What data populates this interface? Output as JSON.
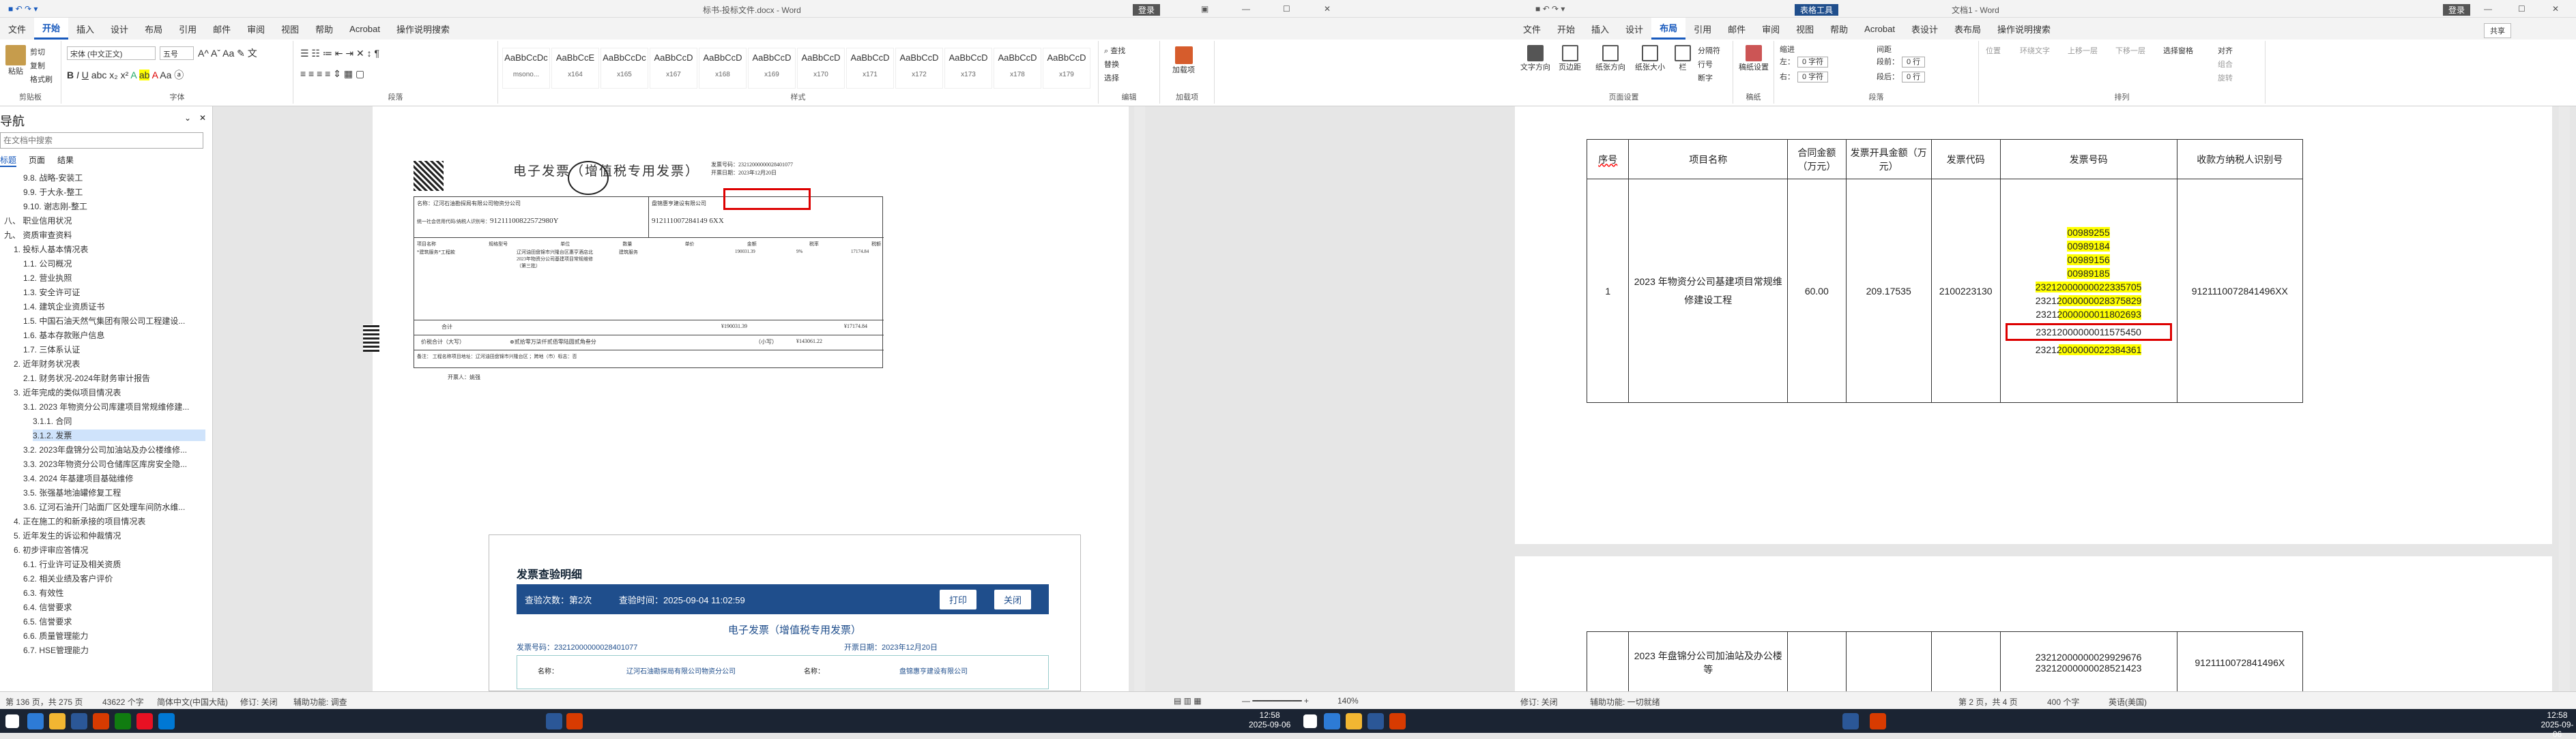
{
  "left_window": {
    "title": "标书-投标文件.docx - Word",
    "titlebar_user": "登录",
    "tabs": [
      "文件",
      "开始",
      "插入",
      "设计",
      "布局",
      "引用",
      "邮件",
      "审阅",
      "视图",
      "帮助",
      "Acrobat",
      "操作说明搜索"
    ],
    "active_tab": "开始",
    "ribbon": {
      "clipboard_label": "剪贴板",
      "paste": "粘贴",
      "cut": "剪切",
      "copy": "复制",
      "format_painter": "格式刷",
      "font_label": "字体",
      "font_name": "宋体 (中文正文)",
      "font_size": "五号",
      "paragraph_label": "段落",
      "styles_label": "样式",
      "styles": [
        {
          "p": "AaBbCcDc",
          "n": "msono..."
        },
        {
          "p": "AaBbCcE",
          "n": "x164"
        },
        {
          "p": "AaBbCcDc",
          "n": "x165"
        },
        {
          "p": "AaBbCcD",
          "n": "x167"
        },
        {
          "p": "AaBbCcD",
          "n": "x168"
        },
        {
          "p": "AaBbCcD",
          "n": "x169"
        },
        {
          "p": "AaBbCcD",
          "n": "x170"
        },
        {
          "p": "AaBbCcD",
          "n": "x171"
        },
        {
          "p": "AaBbCcD",
          "n": "x172"
        },
        {
          "p": "AaBbCcD",
          "n": "x173"
        },
        {
          "p": "AaBbCcD",
          "n": "x178"
        },
        {
          "p": "AaBbCcD",
          "n": "x179"
        }
      ],
      "editing_label": "编辑",
      "find": "查找",
      "replace": "替换",
      "select": "选择",
      "addin_label": "加载项",
      "addin": "加载项"
    },
    "nav": {
      "title": "导航",
      "search_placeholder": "在文档中搜索",
      "tabs": [
        "标题",
        "页面",
        "结果"
      ],
      "items": [
        {
          "t": "9.8. 战略-安装工",
          "i": 2
        },
        {
          "t": "9.9. 于大永-整工",
          "i": 2
        },
        {
          "t": "9.10. 谢志刚-整工",
          "i": 2
        },
        {
          "t": "八、 职业信用状况",
          "i": 0
        },
        {
          "t": "九、 资质审查资料",
          "i": 0
        },
        {
          "t": "1. 投标人基本情况表",
          "i": 1
        },
        {
          "t": "1.1. 公司概况",
          "i": 2
        },
        {
          "t": "1.2. 营业执照",
          "i": 2
        },
        {
          "t": "1.3. 安全许可证",
          "i": 2
        },
        {
          "t": "1.4. 建筑企业资质证书",
          "i": 2
        },
        {
          "t": "1.5. 中国石油天然气集团有限公司工程建设...",
          "i": 2
        },
        {
          "t": "1.6. 基本存款账户信息",
          "i": 2
        },
        {
          "t": "1.7. 三体系认证",
          "i": 2
        },
        {
          "t": "2. 近年财务状况表",
          "i": 1
        },
        {
          "t": "2.1. 财务状况-2024年财务审计报告",
          "i": 2
        },
        {
          "t": "3. 近年完成的类似项目情况表",
          "i": 1
        },
        {
          "t": "3.1. 2023 年物资分公司库建项目常规维修建...",
          "i": 2
        },
        {
          "t": "3.1.1. 合同",
          "i": 3
        },
        {
          "t": "3.1.2. 发票",
          "i": 3,
          "sel": true
        },
        {
          "t": "3.2. 2023年盘锦分公司加油站及办公楼维修...",
          "i": 2
        },
        {
          "t": "3.3. 2023年物资分公司仓储库区库房安全隐...",
          "i": 2
        },
        {
          "t": "3.4. 2024 年基建项目基础维修",
          "i": 2
        },
        {
          "t": "3.5. 张强基地油罐修复工程",
          "i": 2
        },
        {
          "t": "3.6. 辽河石油开门站面厂区处理车间防水维...",
          "i": 2
        },
        {
          "t": "4. 正在施工的和新承接的项目情况表",
          "i": 1
        },
        {
          "t": "5. 近年发生的诉讼和仲裁情况",
          "i": 1
        },
        {
          "t": "6. 初步评审应答情况",
          "i": 1
        },
        {
          "t": "6.1. 行业许可证及相关资质",
          "i": 2
        },
        {
          "t": "6.2. 相关业绩及客户评价",
          "i": 2
        },
        {
          "t": "6.3. 有效性",
          "i": 2
        },
        {
          "t": "6.4. 信誉要求",
          "i": 2
        },
        {
          "t": "6.5. 信誉要求",
          "i": 2
        },
        {
          "t": "6.6. 质量管理能力",
          "i": 2
        },
        {
          "t": "6.7. HSE管理能力",
          "i": 2
        }
      ]
    },
    "invoice": {
      "title": "电子发票（增值税专用发票）",
      "number_label": "发票号码：",
      "number": "23212000000028401077",
      "date_label": "开票日期：",
      "date": "2023年12月20日",
      "buyer_label": "购买方信息",
      "buyer_name_label": "名称：",
      "buyer_name": "辽河石油勘探局有限公司物资分公司",
      "buyer_tax_label": "统一社会信用代码/纳税人识别号：",
      "buyer_tax": "91211100822572980Y",
      "seller_label": "销售方信息",
      "seller_name": "盘锦惠亨建设有限公司",
      "seller_tax": "912111007284149 6XX",
      "item_header": [
        "项目名称",
        "规格型号",
        "单位",
        "数量",
        "单价",
        "金额",
        "税率",
        "税额"
      ],
      "item_name": "*建筑服务*工程款",
      "item_desc": "辽河油田盘锦市兴隆台区惠亨酒店北 2023年物资分公司基建项目常规维修（第三批）",
      "item_unit": "建筑服务",
      "item_amount": "190031.39",
      "item_rate": "9%",
      "item_tax": "17174.84",
      "total_label": "合计",
      "total_amount": "¥190031.39",
      "total_tax": "¥17174.84",
      "sum_caps_label": "价税合计（大写）",
      "sum_caps": "⊗贰拾零万柒仟贰佰零陆圆贰角叁分",
      "sum_small_label": "（小写）",
      "sum_small": "¥143061.22",
      "remark_label": "备注",
      "remark": "工程名称项目地址：辽河油田盘锦市兴隆台区 ；跨地（市）标志：否",
      "issuer_label": "开票人：",
      "issuer": "姚强"
    },
    "verify": {
      "title": "发票查验明细",
      "count_label": "查验次数：",
      "count": "第2次",
      "time_label": "查验时间：",
      "time": "2025-09-04 11:02:59",
      "print": "打印",
      "close": "关闭",
      "doc_title": "电子发票（增值税专用发票）",
      "number_label": "发票号码：",
      "number": "23212000000028401077",
      "date_label": "开票日期：",
      "date": "2023年12月20日",
      "buyer_name": "辽河石油勘探局有限公司物资分公司",
      "seller_name": "盘锦惠亨建设有限公司",
      "name_label": "名称："
    },
    "status": {
      "page": "第 136 页，共 275 页",
      "words": "43622 个字",
      "lang": "简体中文(中国大陆)",
      "track": "修订: 关闭",
      "access": "辅助功能: 调查",
      "zoom": "140%"
    }
  },
  "right_window": {
    "title": "文档1 - Word",
    "context_title": "表格工具",
    "titlebar_user": "登录",
    "tabs": [
      "文件",
      "开始",
      "插入",
      "设计",
      "布局",
      "引用",
      "邮件",
      "审阅",
      "视图",
      "帮助",
      "Acrobat",
      "表设计",
      "表布局",
      "操作说明搜索"
    ],
    "active_tab": "布局",
    "share": "共享",
    "ribbon": {
      "page_setup_label": "页面设置",
      "text_dir": "文字方向",
      "margins": "页边距",
      "orientation": "纸张方向",
      "size": "纸张大小",
      "columns": "栏",
      "breaks": "分隔符",
      "line_numbers": "行号",
      "hyphen": "断字",
      "manuscript_label": "稿纸",
      "manuscript": "稿纸设置",
      "paragraph_label": "段落",
      "indent_label": "缩进",
      "spacing_label": "间距",
      "left_label": "左：",
      "right_label": "右：",
      "before_label": "段前：",
      "after_label": "段后：",
      "indent_left": "0 字符",
      "indent_right": "0 字符",
      "space_before": "0 行",
      "space_after": "0 行",
      "arrange_label": "排列",
      "position": "位置",
      "wrap": "环绕文字",
      "forward": "上移一层",
      "backward": "下移一层",
      "selection_pane": "选择窗格",
      "align": "对齐",
      "group": "组合",
      "rotate": "旋转"
    },
    "table": {
      "headers": [
        "序号",
        "项目名称",
        "合同金额（万元）",
        "发票开具金额（万元）",
        "发票代码",
        "发票号码",
        "收款方纳税人识别号"
      ],
      "row1": {
        "no": "1",
        "name": "2023 年物资分公司基建项目常规维修建设工程",
        "contract": "60.00",
        "invoice": "209.17535",
        "code": "2100223130",
        "numbers": [
          {
            "t": "00989255",
            "h": "full"
          },
          {
            "t": "00989184",
            "h": "full"
          },
          {
            "t": "00989156",
            "h": "full"
          },
          {
            "t": "00989185",
            "h": "full"
          },
          {
            "t": "23212000000022335705",
            "h": "full"
          },
          {
            "t": "23212000000028375829",
            "h": "part"
          },
          {
            "t": "23212000000011802693",
            "h": "part"
          },
          {
            "t": "23212000000011575450",
            "h": "none",
            "box": true
          },
          {
            "t": "23212000000022384361",
            "h": "part"
          }
        ],
        "taxid": "9121110072841496XX"
      },
      "row2": {
        "name": "2023 年盘锦分公司加油站及办公楼等",
        "numbers": [
          "23212000000029929676",
          "23212000000028521423"
        ],
        "taxid": "9121110072841496X"
      }
    },
    "status": {
      "page": "第 2 页，共 4 页",
      "words": "400 个字",
      "lang": "英语(美国)",
      "track": "修订: 关闭",
      "access": "辅助功能: 一切就绪"
    }
  },
  "taskbar": {
    "clock1_time": "12:58",
    "clock1_date": "2025-09-06",
    "clock2_time": "12:58",
    "clock2_date": "2025-09-06"
  }
}
